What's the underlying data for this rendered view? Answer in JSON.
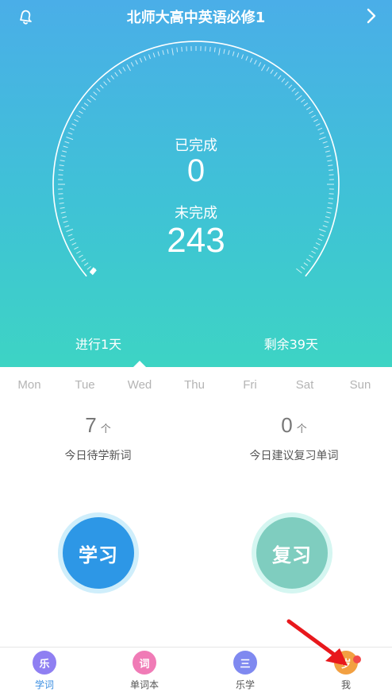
{
  "header": {
    "title": "北师大高中英语必修1"
  },
  "stats": {
    "completed_label": "已完成",
    "completed_value": "0",
    "remaining_label": "未完成",
    "remaining_value": "243"
  },
  "progress": {
    "days_elapsed": "进行1天",
    "days_left": "剩余39天"
  },
  "week": {
    "days": [
      "Mon",
      "Tue",
      "Wed",
      "Thu",
      "Fri",
      "Sat",
      "Sun"
    ],
    "selected_index": 2
  },
  "counts": {
    "new_words_value": "7",
    "new_words_unit": "个",
    "new_words_label": "今日待学新词",
    "review_value": "0",
    "review_unit": "个",
    "review_label": "今日建议复习单词"
  },
  "actions": {
    "learn_label": "学习",
    "review_label": "复习"
  },
  "tabbar": {
    "items": [
      {
        "icon_char": "乐",
        "label": "学词",
        "color": "#8f7ff2",
        "active": true
      },
      {
        "icon_char": "词",
        "label": "单词本",
        "color": "#f07bb6",
        "active": false
      },
      {
        "icon_char": "三",
        "label": "乐学",
        "color": "#7f89f0",
        "active": false
      },
      {
        "icon_char": "岁",
        "label": "我",
        "color": "#f2a041",
        "active": false
      }
    ]
  },
  "colors": {
    "accent": "#3a8de0",
    "learn_button": "#2d97e6",
    "review_button": "#7fcdbf",
    "notification_dot": "#f24a4a",
    "annotation_arrow": "#e8181c"
  },
  "icons": {
    "top_left": "bell-icon",
    "top_right": "chevron-right-icon"
  }
}
